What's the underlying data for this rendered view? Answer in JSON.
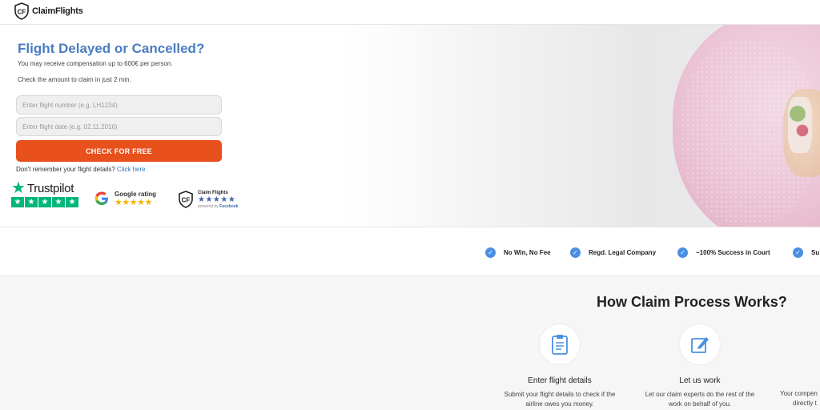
{
  "header": {
    "logo_text": "ClaimFlights"
  },
  "hero": {
    "title": "Flight Delayed or Cancelled?",
    "subtitle_1": "You may receive compensation up to 600€ per person.",
    "subtitle_2": "Check the amount to claim in just 2 min.",
    "flight_number_placeholder": "Enter flight number (e.g. LH1234)",
    "flight_date_placeholder": "Enter flight date (e.g. 02.11.2016)",
    "cta_label": "CHECK FOR FREE",
    "remember_text": "Don't remember your flight details?",
    "remember_link": "Click here"
  },
  "ratings": {
    "trustpilot": {
      "name": "Trustpilot",
      "stars": 5
    },
    "google": {
      "logo": "G",
      "title": "Google rating",
      "stars": "★★★★★"
    },
    "claimflights_facebook": {
      "brand": "Claim Flights",
      "stars": "★★★★★",
      "powered_prefix": "powered by",
      "powered_brand": "Facebook"
    }
  },
  "badges": [
    {
      "label": "No Win, No Fee",
      "icon": "check-icon"
    },
    {
      "label": "Regd. Legal Company",
      "icon": "check-icon"
    },
    {
      "label": "~100% Success in Court",
      "icon": "check-icon"
    },
    {
      "label": "Su",
      "icon": "check-icon"
    }
  ],
  "process": {
    "title": "How Claim Process Works?",
    "steps": [
      {
        "icon": "clipboard-icon",
        "title": "Enter flight details",
        "desc_1": "Submit your flight details to check if the",
        "desc_2": "airline owes you money."
      },
      {
        "icon": "pen-edit-icon",
        "title": "Let us work",
        "desc_1": "Let our claim experts do the rest of the",
        "desc_2": "work on behalf of you."
      },
      {
        "icon": "money-icon",
        "title": "",
        "desc_1": "Your compen",
        "desc_2": "directly t"
      }
    ]
  },
  "colors": {
    "title_blue": "#4a7dc0",
    "cta_orange": "#e8501c",
    "link_blue": "#2f72b8",
    "trustpilot_green": "#00b67a",
    "check_blue": "#4a90e2"
  }
}
